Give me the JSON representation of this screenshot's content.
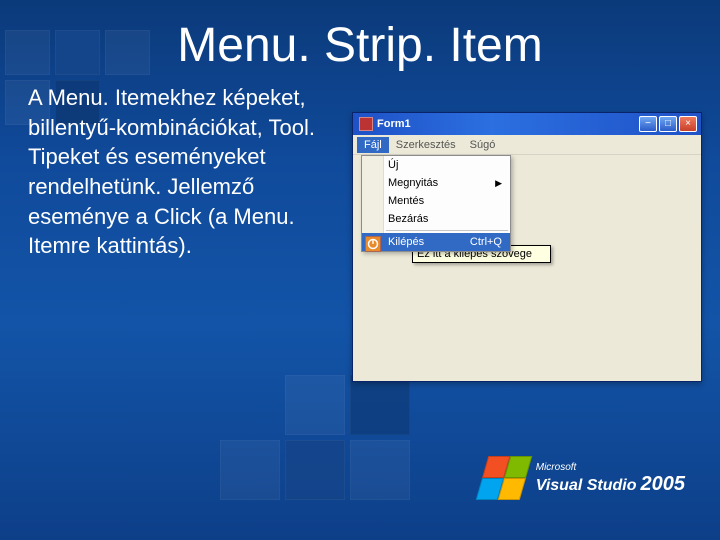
{
  "slide": {
    "title": "Menu. Strip. Item",
    "paragraph": "A Menu. Itemekhez képeket, billentyű-kombinációkat, Tool. Tipeket és eseményeket rendelhetünk. Jellemző eseménye a Click (a Menu. Itemre kattintás)."
  },
  "window": {
    "title": "Form1",
    "buttons": {
      "min": "−",
      "max": "□",
      "close": "×"
    },
    "menubar": {
      "items": [
        {
          "label": "Fájl",
          "active": true
        },
        {
          "label": "Szerkesztés"
        },
        {
          "label": "Súgó"
        }
      ]
    },
    "dropdown": {
      "items": [
        {
          "label": "Új"
        },
        {
          "label": "Megnyitás",
          "submenu": true
        },
        {
          "label": "Mentés"
        },
        {
          "label": "Bezárás"
        }
      ],
      "exit": {
        "label": "Kilépés",
        "shortcut": "Ctrl+Q"
      },
      "tooltip": "Ez itt a kilépés szövege"
    }
  },
  "logo": {
    "brand": "Microsoft",
    "product": "Visual Studio",
    "year": "2005"
  }
}
